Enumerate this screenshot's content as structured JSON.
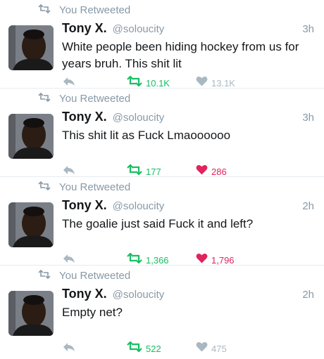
{
  "tweets": [
    {
      "retweet_label": "You Retweeted",
      "name": "Tony X.",
      "handle": "@soloucity",
      "time": "3h",
      "text": "White people been hiding hockey from us for years bruh. This shit lit",
      "retweets": "10.1K",
      "likes": "13.1K",
      "liked": false
    },
    {
      "retweet_label": "You Retweeted",
      "name": "Tony X.",
      "handle": "@soloucity",
      "time": "3h",
      "text": "This shit lit as Fuck Lmaoooooo",
      "retweets": "177",
      "likes": "286",
      "liked": true
    },
    {
      "retweet_label": "You Retweeted",
      "name": "Tony X.",
      "handle": "@soloucity",
      "time": "2h",
      "text": "The goalie just said Fuck it and left?",
      "retweets": "1,366",
      "likes": "1,796",
      "liked": true
    },
    {
      "retweet_label": "You Retweeted",
      "name": "Tony X.",
      "handle": "@soloucity",
      "time": "2h",
      "text": "Empty net?",
      "retweets": "522",
      "likes": "475",
      "liked": false
    }
  ],
  "colors": {
    "retweet_green": "#17bf63",
    "like_red": "#e0245e",
    "muted_gray": "#8899a6"
  }
}
